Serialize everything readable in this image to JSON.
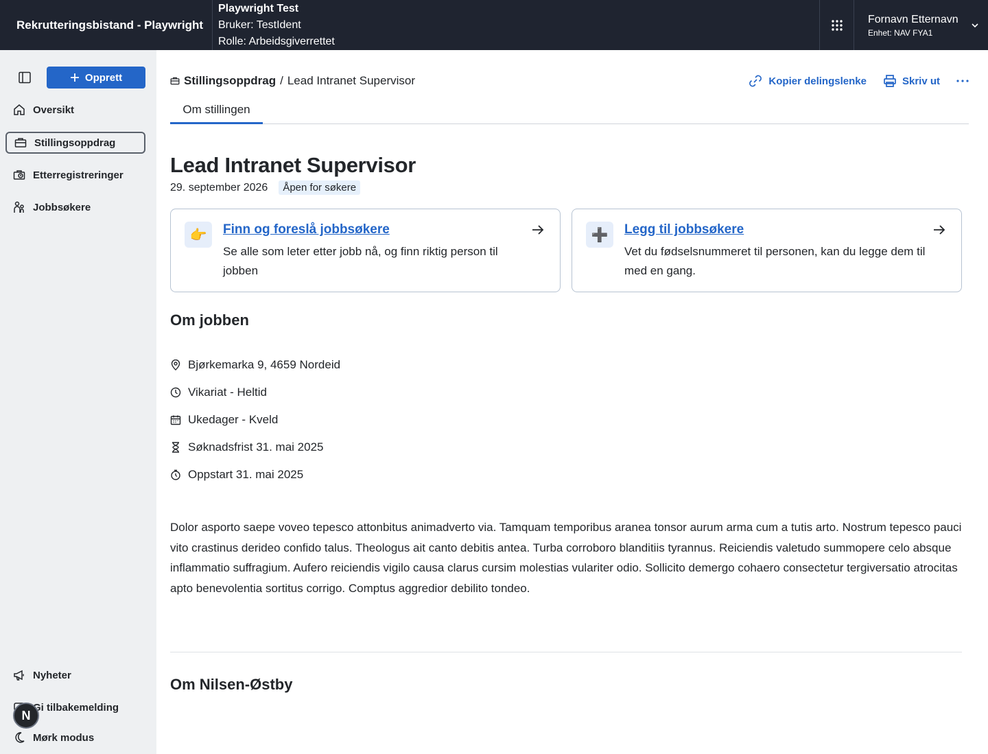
{
  "topbar": {
    "app_title": "Rekrutteringsbistand - Playwright",
    "env_title": "Playwright Test",
    "user": "Bruker: TestIdent",
    "role": "Rolle: Arbeidsgiverrettet",
    "account_name": "Fornavn Etternavn",
    "account_unit": "Enhet: NAV FYA1"
  },
  "sidebar": {
    "create_label": "Opprett",
    "items": [
      {
        "label": "Oversikt",
        "icon": "house-icon"
      },
      {
        "label": "Stillingsoppdrag",
        "icon": "briefcase-icon",
        "active": true
      },
      {
        "label": "Etterregistreringer",
        "icon": "briefcase-clock-icon"
      },
      {
        "label": "Jobbsøkere",
        "icon": "people-icon"
      }
    ],
    "bottom_items": [
      {
        "label": "Nyheter",
        "icon": "megaphone-icon"
      },
      {
        "label": "Gi tilbakemelding",
        "icon": "chat-icon"
      },
      {
        "label": "Mørk modus",
        "icon": "moon-icon"
      }
    ],
    "feedback_avatar": "N"
  },
  "header": {
    "breadcrumb_root": "Stillingsoppdrag",
    "breadcrumb_sep": "/",
    "breadcrumb_current": "Lead Intranet Supervisor",
    "copy_link": "Kopier delingslenke",
    "print": "Skriv ut",
    "tab": "Om stillingen"
  },
  "job": {
    "title": "Lead Intranet Supervisor",
    "date": "29. september 2026",
    "status": "Åpen for søkere"
  },
  "cards": [
    {
      "icon": "👉",
      "title": "Finn og foreslå jobbsøkere",
      "desc": "Se alle som leter etter jobb nå, og finn riktig person til jobben"
    },
    {
      "icon": "➕",
      "title": "Legg til jobbsøkere",
      "desc": "Vet du fødselsnummeret til personen, kan du legge dem til med en gang."
    }
  ],
  "about": {
    "heading": "Om jobben",
    "facts": [
      {
        "icon": "location-pin-icon",
        "text": "Bjørkemarka 9, 4659 Nordeid"
      },
      {
        "icon": "clock-icon",
        "text": "Vikariat - Heltid"
      },
      {
        "icon": "calendar-icon",
        "text": "Ukedager - Kveld"
      },
      {
        "icon": "hourglass-icon",
        "text": "Søknadsfrist 31. mai 2025"
      },
      {
        "icon": "stopwatch-icon",
        "text": "Oppstart 31. mai 2025"
      }
    ],
    "description": "Dolor asporto saepe voveo tepesco attonbitus animadverto via. Tamquam temporibus aranea tonsor aurum arma cum a tutis arto. Nostrum tepesco pauci vito crastinus derideo confido talus. Theologus ait canto debitis antea. Turba corroboro blanditiis tyrannus. Reiciendis valetudo summopere celo absque inflammatio suffragium. Aufero reiciendis vigilo causa clarus cursim molestias vulariter odio. Sollicito demergo cohaero consectetur tergiversatio atrocitas apto benevolentia sortitus corrigo. Comptus aggredior debilito tondeo."
  },
  "employer": {
    "heading": "Om Nilsen-Østby"
  }
}
